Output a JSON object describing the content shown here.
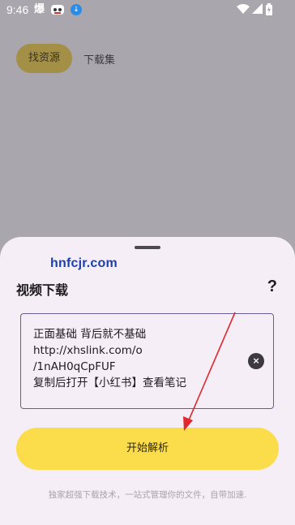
{
  "status_bar": {
    "time": "9:46",
    "notif_icon_1": "爆",
    "notif_icon_2": "mascot-icon",
    "notif_icon_3": "download-icon",
    "right_icons": [
      "wifi-icon",
      "signal-icon",
      "battery-icon"
    ]
  },
  "tabs": [
    {
      "label": "找资源",
      "active": true
    },
    {
      "label": "下载集",
      "active": false
    }
  ],
  "sheet": {
    "watermark": "hnfcjr.com",
    "title": "视频下载",
    "help_label": "?",
    "input_value": "正面基础 背后就不基础\nhttp://xhslink.com/o\n/1nAH0qCpFUF\n复制后打开【小红书】查看笔记",
    "clear_label": "×",
    "primary_button": "开始解析",
    "footer_note": "独家超强下载技术，一站式管理你的文件，自带加速."
  },
  "colors": {
    "scrim": "#a9a6ad",
    "sheet_bg": "#f5eef6",
    "accent_yellow": "#fbdd4c",
    "tab_active": "#a38f45",
    "input_border": "#6c5a93",
    "annotation_arrow": "#e0282e"
  }
}
